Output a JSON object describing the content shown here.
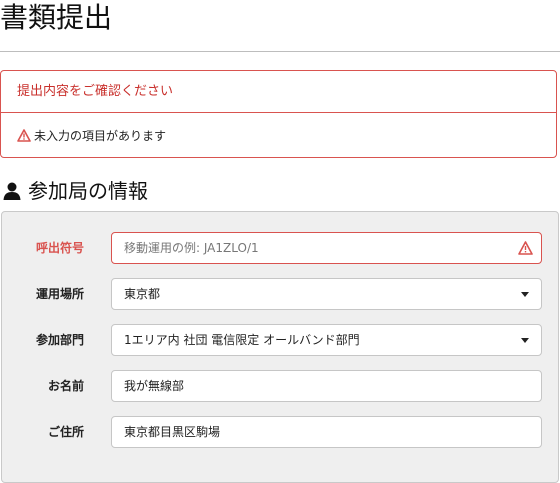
{
  "page": {
    "title": "書類提出"
  },
  "alert": {
    "heading": "提出内容をご確認ください",
    "message": "未入力の項目があります"
  },
  "section": {
    "title": "参加局の情報"
  },
  "form": {
    "callsign": {
      "label": "呼出符号",
      "placeholder": "移動運用の例: JA1ZLO/1",
      "value": ""
    },
    "location": {
      "label": "運用場所",
      "value": "東京都"
    },
    "category": {
      "label": "参加部門",
      "value": "1エリア内 社団 電信限定 オールバンド部門"
    },
    "name": {
      "label": "お名前",
      "value": "我が無線部"
    },
    "address": {
      "label": "ご住所",
      "value": "東京都目黒区駒場"
    }
  },
  "colors": {
    "error": "#d9534f",
    "panel": "#efefef"
  },
  "icons": {
    "warning": "warning-icon",
    "user": "user-icon",
    "dropdown": "chevron-down-icon"
  }
}
